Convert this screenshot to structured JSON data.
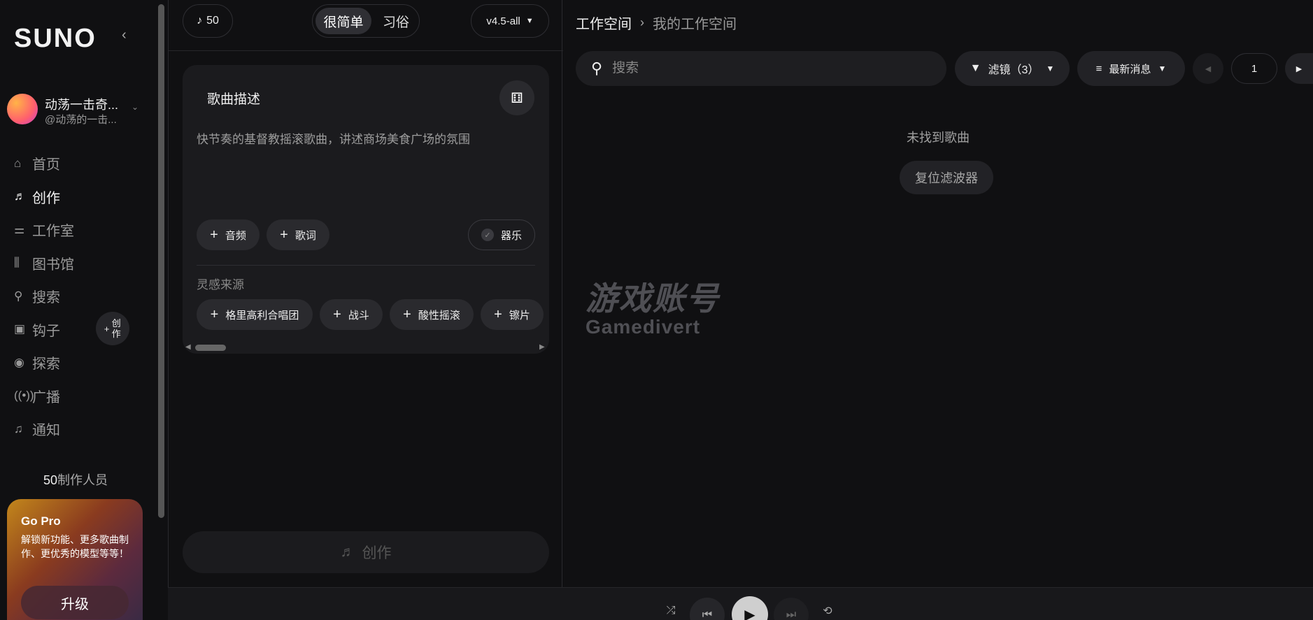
{
  "sidebar": {
    "logo": "SUNO",
    "user": {
      "name": "动荡一击奇...",
      "handle": "@动荡的一击..."
    },
    "nav": [
      {
        "label": "首页",
        "icon": "home-icon",
        "active": false
      },
      {
        "label": "创作",
        "icon": "music-create-icon",
        "active": true
      },
      {
        "label": "工作室",
        "icon": "studio-icon",
        "active": false
      },
      {
        "label": "图书馆",
        "icon": "library-icon",
        "active": false
      },
      {
        "label": "搜索",
        "icon": "search-icon",
        "active": false
      },
      {
        "label": "钩子",
        "icon": "hook-icon",
        "active": false
      },
      {
        "label": "探索",
        "icon": "explore-icon",
        "active": false
      },
      {
        "label": "广播",
        "icon": "broadcast-icon",
        "active": false
      },
      {
        "label": "通知",
        "icon": "bell-icon",
        "active": false
      }
    ],
    "hook_create_label": "创作",
    "credits_count": "50",
    "credits_label": "制作人员",
    "gopro": {
      "title": "Go Pro",
      "description": "解锁新功能、更多歌曲制作、更优秀的模型等等！",
      "upgrade_label": "升级"
    }
  },
  "create_panel": {
    "credits_badge": "50",
    "mode_simple": "很简单",
    "mode_custom": "习俗",
    "model": "v4.5-all",
    "description_label": "歌曲描述",
    "description_text": "快节奏的基督教摇滚歌曲，讲述商场美食广场的氛围",
    "add_audio": "音频",
    "add_lyrics": "歌词",
    "instrumental": "器乐",
    "inspiration_label": "灵感来源",
    "inspiration_tags": [
      "格里高利合唱团",
      "战斗",
      "酸性摇滚",
      "镲片"
    ],
    "create_label": "创作"
  },
  "workspace": {
    "breadcrumb_root": "工作空间",
    "breadcrumb_current": "我的工作空间",
    "search_placeholder": "搜索",
    "filter_label": "滤镜（3）",
    "sort_label": "最新消息",
    "page": "1",
    "empty_text": "未找到歌曲",
    "reset_label": "复位滤波器"
  },
  "watermark": {
    "cn": "游戏账号",
    "en": "Gamedivert"
  },
  "colors": {
    "background": "#101012",
    "card": "#1b1b1e",
    "accent": "#ffffff"
  }
}
